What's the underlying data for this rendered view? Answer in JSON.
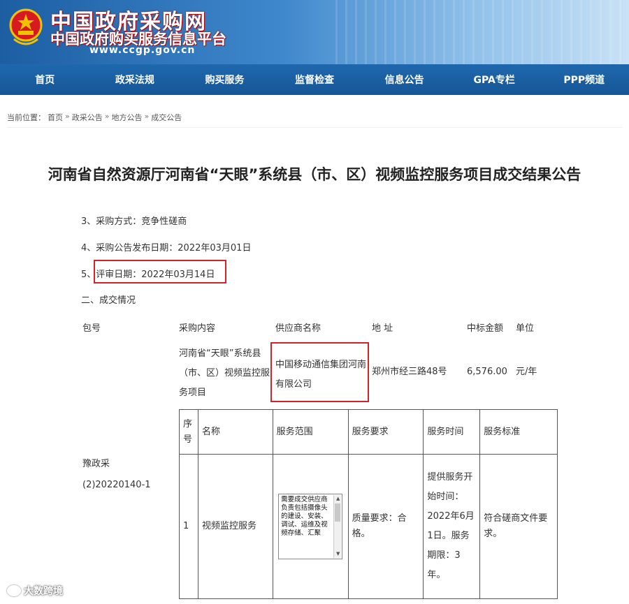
{
  "header": {
    "site_name": "中国政府采购网",
    "site_subtitle": "中国政府购买服务信息平台",
    "site_url": "www.ccgp.gov.cn",
    "brand_color": "#1f68ae"
  },
  "nav": {
    "items": [
      "首页",
      "政采法规",
      "购买服务",
      "监督检查",
      "信息公告",
      "GPA专栏",
      "PPP频道"
    ]
  },
  "breadcrumb": {
    "prefix": "当前位置：",
    "items": [
      "首页",
      "政采公告",
      "地方公告",
      "成交公告"
    ],
    "separator": "»"
  },
  "article": {
    "title": "河南省自然资源厅河南省“天眼”系统县（市、区）视频监控服务项目成交结果公告",
    "lines": {
      "method": "3、采购方式：竞争性磋商",
      "publish_date": "4、采购公告发布日期：2022年03月01日",
      "review_prefix": "5、",
      "review_date": "评审日期：2022年03月14日",
      "section": "二、成交情况"
    }
  },
  "deal_table": {
    "headers": [
      "包号",
      "采购内容",
      "供应商名称",
      "地 址",
      "中标金额",
      "单位"
    ],
    "package_no": "豫政采(2)20220140-1",
    "content": "河南省“天眼”系统县（市、区）视频监控服务项目",
    "supplier": "中国移动通信集团河南有限公司",
    "address": "郑州市经三路48号",
    "amount": "6,576.00",
    "unit": "元/年"
  },
  "service_table": {
    "headers": [
      "序号",
      "名称",
      "服务范围",
      "服务要求",
      "服务时间",
      "服务标准"
    ],
    "row": {
      "index": "1",
      "name": "视频监控服务",
      "scope": "需要成交供应商负责包括摄像头的建设、安装、调试、运维及视频存储、汇聚",
      "requirement": "质量要求：合格。",
      "time": "提供服务开始时间：2022年6月1日。服务期限：3年。",
      "standard": "符合磋商文件要求。"
    }
  },
  "watermark": {
    "text": "大数跨境"
  },
  "colors": {
    "highlight": "#d2232a"
  }
}
